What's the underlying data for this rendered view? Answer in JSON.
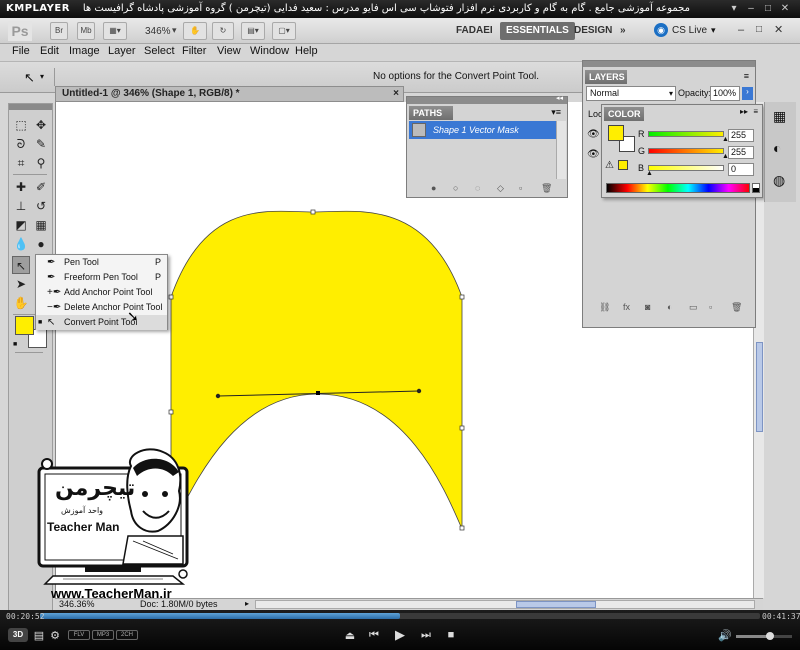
{
  "kmplayer": {
    "logo": "KMPLAYER",
    "title": "مجموعه آموزشی جامع . گام به گام و کاربردی نرم افزار فتوشاپ سی اس فایو  مدرس : سعید فدایی (تیچرمن ) گروه آموزشی پادشاه گرافیست ها",
    "time_elapsed": "00:20:52",
    "time_total": "00:41:37",
    "progress": 0.5,
    "buttons": [
      "3D",
      "FLV",
      "MP3",
      "2CH"
    ]
  },
  "appbar": {
    "logo": "Ps",
    "br_label": "Br",
    "mb_label": "Mb",
    "zoom": "346%",
    "workspaces": [
      "FADAEI",
      "ESSENTIALS",
      "DESIGN"
    ],
    "more": "»",
    "cs_live": "CS Live"
  },
  "menu": [
    "File",
    "Edit",
    "Image",
    "Layer",
    "Select",
    "Filter",
    "View",
    "Window",
    "Help"
  ],
  "options_bar": {
    "message": "No options for the Convert Point Tool."
  },
  "document": {
    "tab": "Untitled-1 @ 346% (Shape 1, RGB/8) *",
    "close": "×"
  },
  "status": {
    "zoom": "346.36%",
    "doc": "Doc: 1.80M/0 bytes"
  },
  "paths_panel": {
    "tab": "PATHS",
    "item": "Shape 1 Vector Mask"
  },
  "layers_panel": {
    "tab": "LAYERS",
    "blend_mode": "Normal",
    "opacity_label": "Opacity:",
    "opacity": "100%",
    "lock_label": "Loc"
  },
  "color_panel": {
    "tab": "COLOR",
    "channels": [
      {
        "label": "R",
        "value": "255",
        "fill": 1.0
      },
      {
        "label": "G",
        "value": "255",
        "fill": 1.0
      },
      {
        "label": "B",
        "value": "0",
        "fill": 0.0
      }
    ],
    "foreground": "#ffee00",
    "background": "#ffffff"
  },
  "pen_flyout": {
    "items": [
      {
        "label": "Pen Tool",
        "shortcut": "P",
        "icon": "pen-icon"
      },
      {
        "label": "Freeform Pen Tool",
        "shortcut": "P",
        "icon": "freeform-pen-icon"
      },
      {
        "label": "Add Anchor Point Tool",
        "shortcut": "",
        "icon": "add-anchor-icon"
      },
      {
        "label": "Delete Anchor Point Tool",
        "shortcut": "",
        "icon": "delete-anchor-icon"
      },
      {
        "label": "Convert Point Tool",
        "shortcut": "",
        "icon": "convert-point-icon",
        "selected": true
      }
    ]
  },
  "watermark": {
    "logo_text": "تیچرمن",
    "subtitle": "واحد آموزش",
    "name": "Teacher Man",
    "url": "www.TeacherMan.ir"
  },
  "colors": {
    "shape_fill": "#ffee00",
    "selection": "#3a78d4"
  }
}
